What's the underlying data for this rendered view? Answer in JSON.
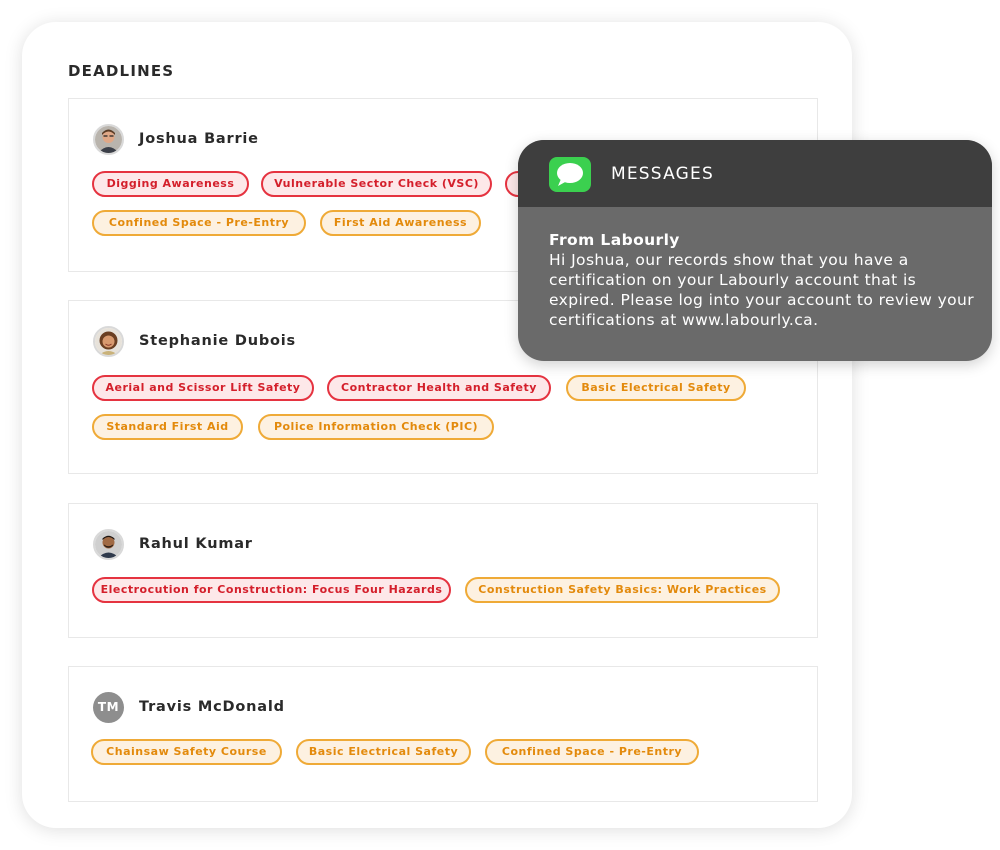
{
  "panel": {
    "title": "DEADLINES"
  },
  "cards": [
    {
      "name": "Joshua Barrie",
      "tags": [
        {
          "label": "Digging Awareness",
          "status": "red"
        },
        {
          "label": "Vulnerable Sector Check (VSC)",
          "status": "red"
        },
        {
          "label": "",
          "status": "red"
        },
        {
          "label": "Confined Space - Pre-Entry",
          "status": "orange"
        },
        {
          "label": "First Aid Awareness",
          "status": "orange"
        }
      ]
    },
    {
      "name": "Stephanie Dubois",
      "tags": [
        {
          "label": "Aerial and Scissor Lift Safety",
          "status": "red"
        },
        {
          "label": "Contractor Health and Safety",
          "status": "red"
        },
        {
          "label": "Basic Electrical Safety",
          "status": "orange"
        },
        {
          "label": "Standard First Aid",
          "status": "orange"
        },
        {
          "label": "Police Information Check (PIC)",
          "status": "orange"
        }
      ]
    },
    {
      "name": "Rahul Kumar",
      "tags": [
        {
          "label": "Electrocution for Construction: Focus Four Hazards",
          "status": "red"
        },
        {
          "label": "Construction Safety Basics:  Work Practices",
          "status": "orange"
        }
      ]
    },
    {
      "name": "Travis McDonald",
      "initials": "TM",
      "tags": [
        {
          "label": "Chainsaw Safety Course",
          "status": "orange"
        },
        {
          "label": "Basic Electrical Safety",
          "status": "orange"
        },
        {
          "label": "Confined Space - Pre-Entry",
          "status": "orange"
        }
      ]
    }
  ],
  "notification": {
    "app": "MESSAGES",
    "icon": "messages-app-icon",
    "from": "From Labourly",
    "text": "Hi Joshua, our records show that you have a certification on your Labourly account that is expired. Please log into your account to review your certifications at www.labourly.ca."
  },
  "colors": {
    "red_border": "#e53340",
    "red_fill": "#fde8e9",
    "orange_border": "#efaa37",
    "orange_fill": "#fdf1e1",
    "messages_green": "#3bd04f"
  }
}
